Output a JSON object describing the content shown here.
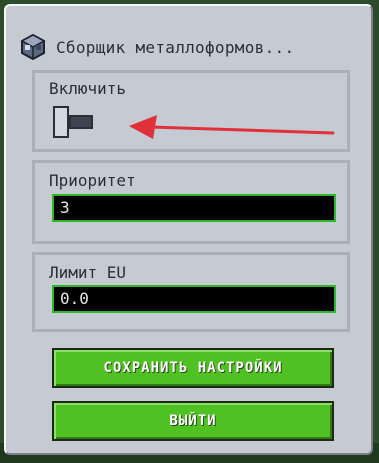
{
  "window": {
    "title": "Сборщик металлоформов..."
  },
  "enable": {
    "label": "Включить",
    "state": "off"
  },
  "priority": {
    "label": "Приоритет",
    "value": "3"
  },
  "limit": {
    "label": "Лимит EU",
    "value": "0.0"
  },
  "buttons": {
    "save_label": "СОХРАНИТЬ НАСТРОЙКИ",
    "exit_label": "ВЫЙТИ"
  },
  "icons": {
    "title": "machine-block-icon",
    "annotation": "red-arrow-icon"
  },
  "colors": {
    "panel": "#c6cad3",
    "button": "#4fc122",
    "field_border": "#2fb82a",
    "arrow": "#e0303a"
  }
}
